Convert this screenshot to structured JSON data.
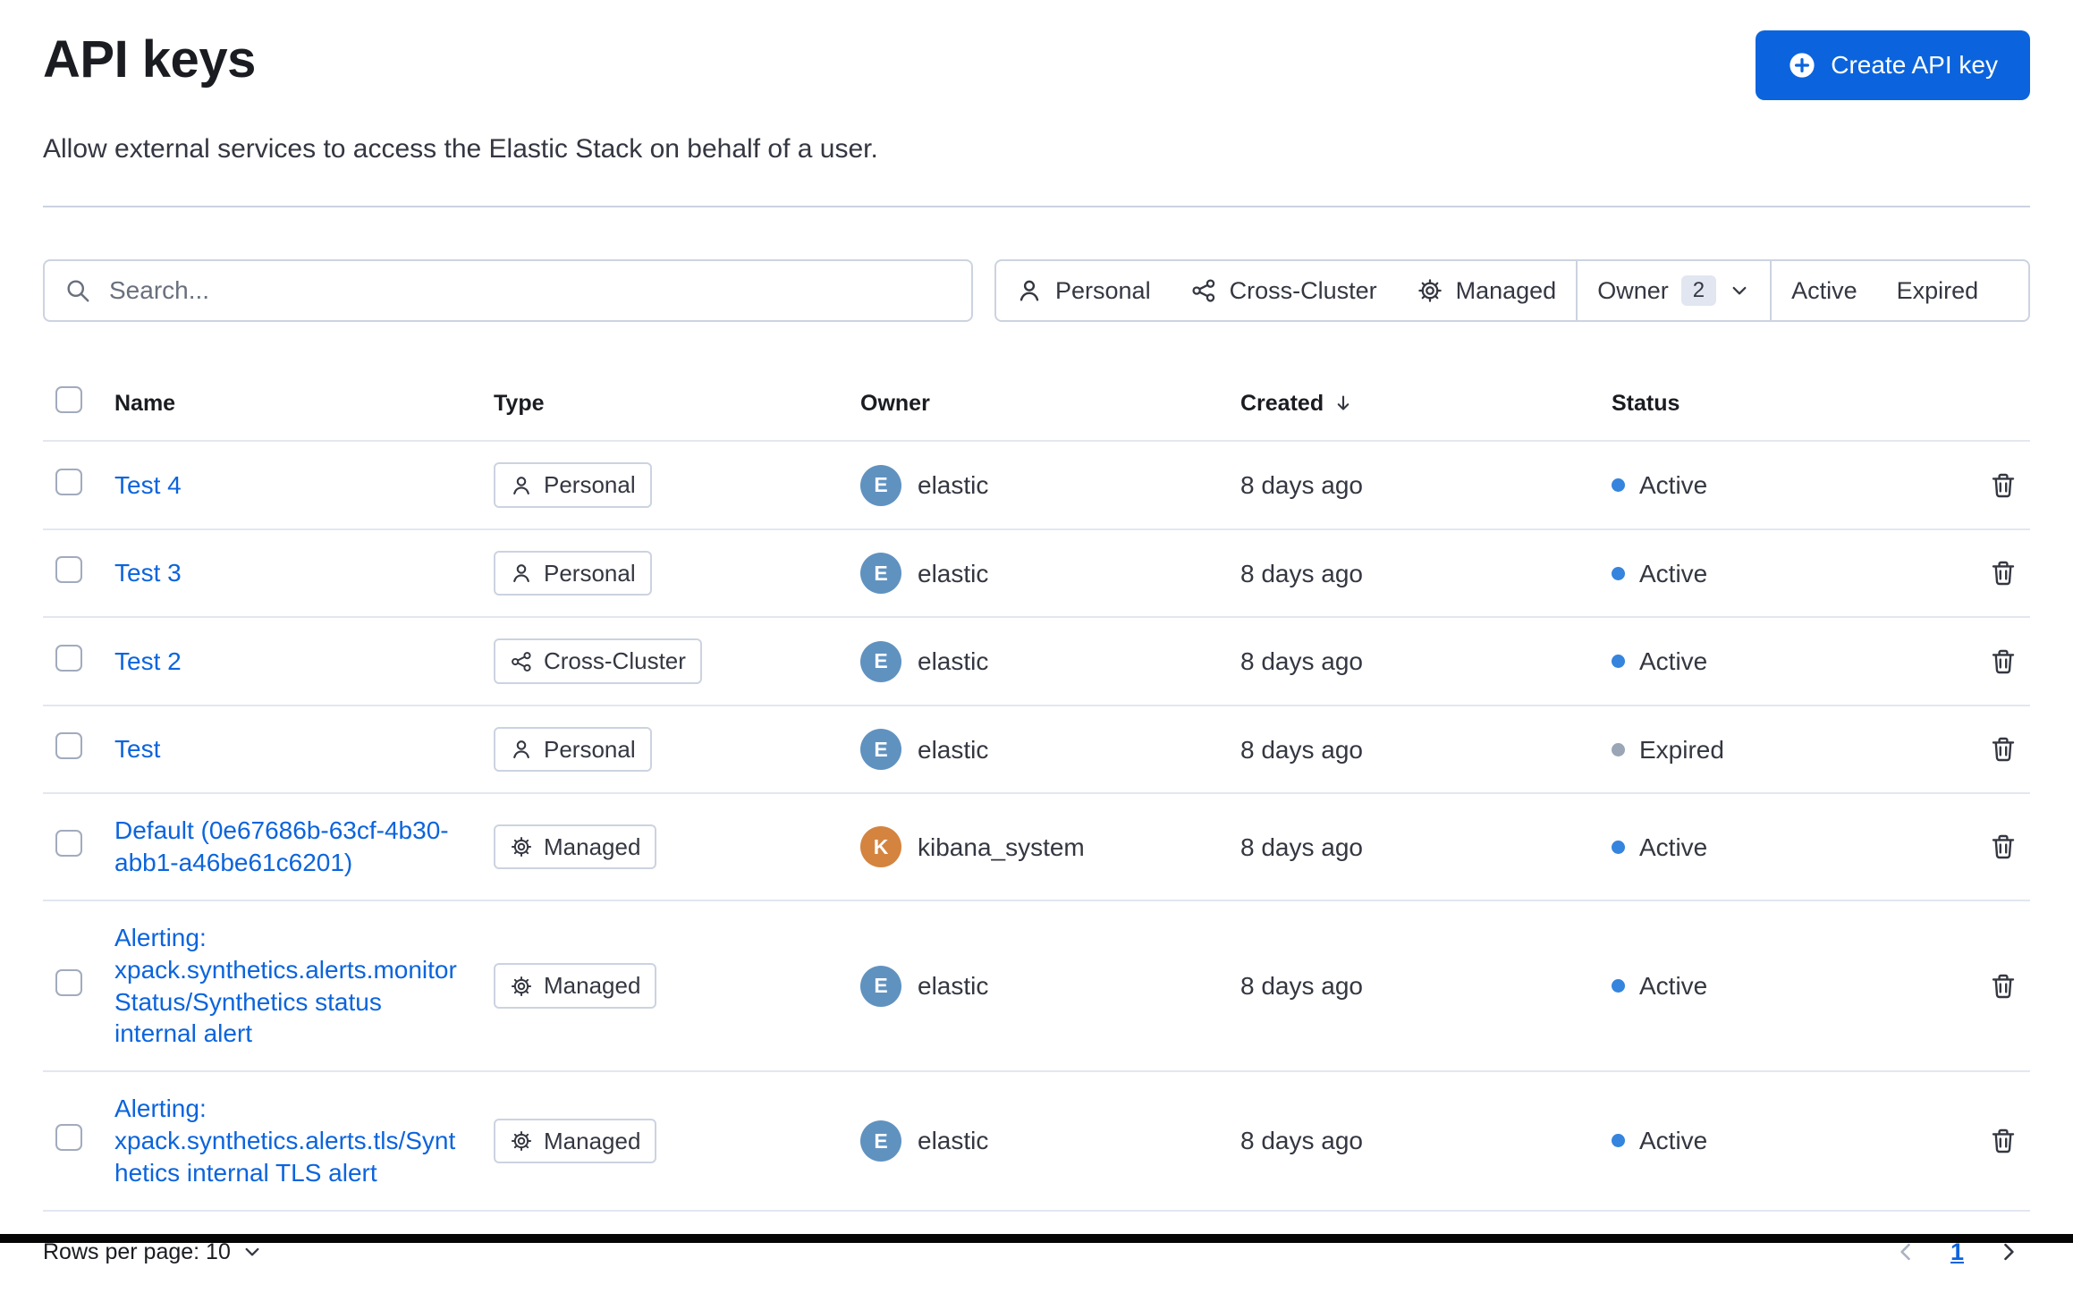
{
  "colors": {
    "accent": "#0b64dd",
    "text": "#343741",
    "heading": "#1a1c21",
    "subdued": "#69707d",
    "control_border": "#ccd3e0",
    "row_border": "#e2e7f0",
    "checkbox_border": "#a2abbd",
    "status_active": "#3584dd",
    "status_expired": "#9aa5b6",
    "avatar_elastic": "#6092c0",
    "avatar_kibana": "#d4843f",
    "count_badge_bg": "#e1e6f0"
  },
  "header": {
    "title": "API keys",
    "subtitle": "Allow external services to access the Elastic Stack on behalf of a user.",
    "create_button_label": "Create API key"
  },
  "toolbar": {
    "search_placeholder": "Search...",
    "filter_personal": "Personal",
    "filter_cross_cluster": "Cross-Cluster",
    "filter_managed": "Managed",
    "filter_owner": "Owner",
    "owner_count": "2",
    "filter_active": "Active",
    "filter_expired": "Expired"
  },
  "table": {
    "headers": {
      "name": "Name",
      "type": "Type",
      "owner": "Owner",
      "created": "Created",
      "status": "Status"
    },
    "rows": [
      {
        "name": "Test 4",
        "type": "Personal",
        "owner": "elastic",
        "owner_initial": "E",
        "created": "8 days ago",
        "status": "Active"
      },
      {
        "name": "Test 3",
        "type": "Personal",
        "owner": "elastic",
        "owner_initial": "E",
        "created": "8 days ago",
        "status": "Active"
      },
      {
        "name": "Test 2",
        "type": "Cross-Cluster",
        "owner": "elastic",
        "owner_initial": "E",
        "created": "8 days ago",
        "status": "Active"
      },
      {
        "name": "Test",
        "type": "Personal",
        "owner": "elastic",
        "owner_initial": "E",
        "created": "8 days ago",
        "status": "Expired"
      },
      {
        "name": "Default (0e67686b-63cf-4b30-abb1-a46be61c6201)",
        "type": "Managed",
        "owner": "kibana_system",
        "owner_initial": "K",
        "created": "8 days ago",
        "status": "Active"
      },
      {
        "name": "Alerting: xpack.synthetics.alerts.monitorStatus/Synthetics status internal alert",
        "type": "Managed",
        "owner": "elastic",
        "owner_initial": "E",
        "created": "8 days ago",
        "status": "Active"
      },
      {
        "name": "Alerting: xpack.synthetics.alerts.tls/Synthetics internal TLS alert",
        "type": "Managed",
        "owner": "elastic",
        "owner_initial": "E",
        "created": "8 days ago",
        "status": "Active"
      }
    ]
  },
  "footer": {
    "rows_per_page_label": "Rows per page: 10",
    "current_page": "1"
  }
}
